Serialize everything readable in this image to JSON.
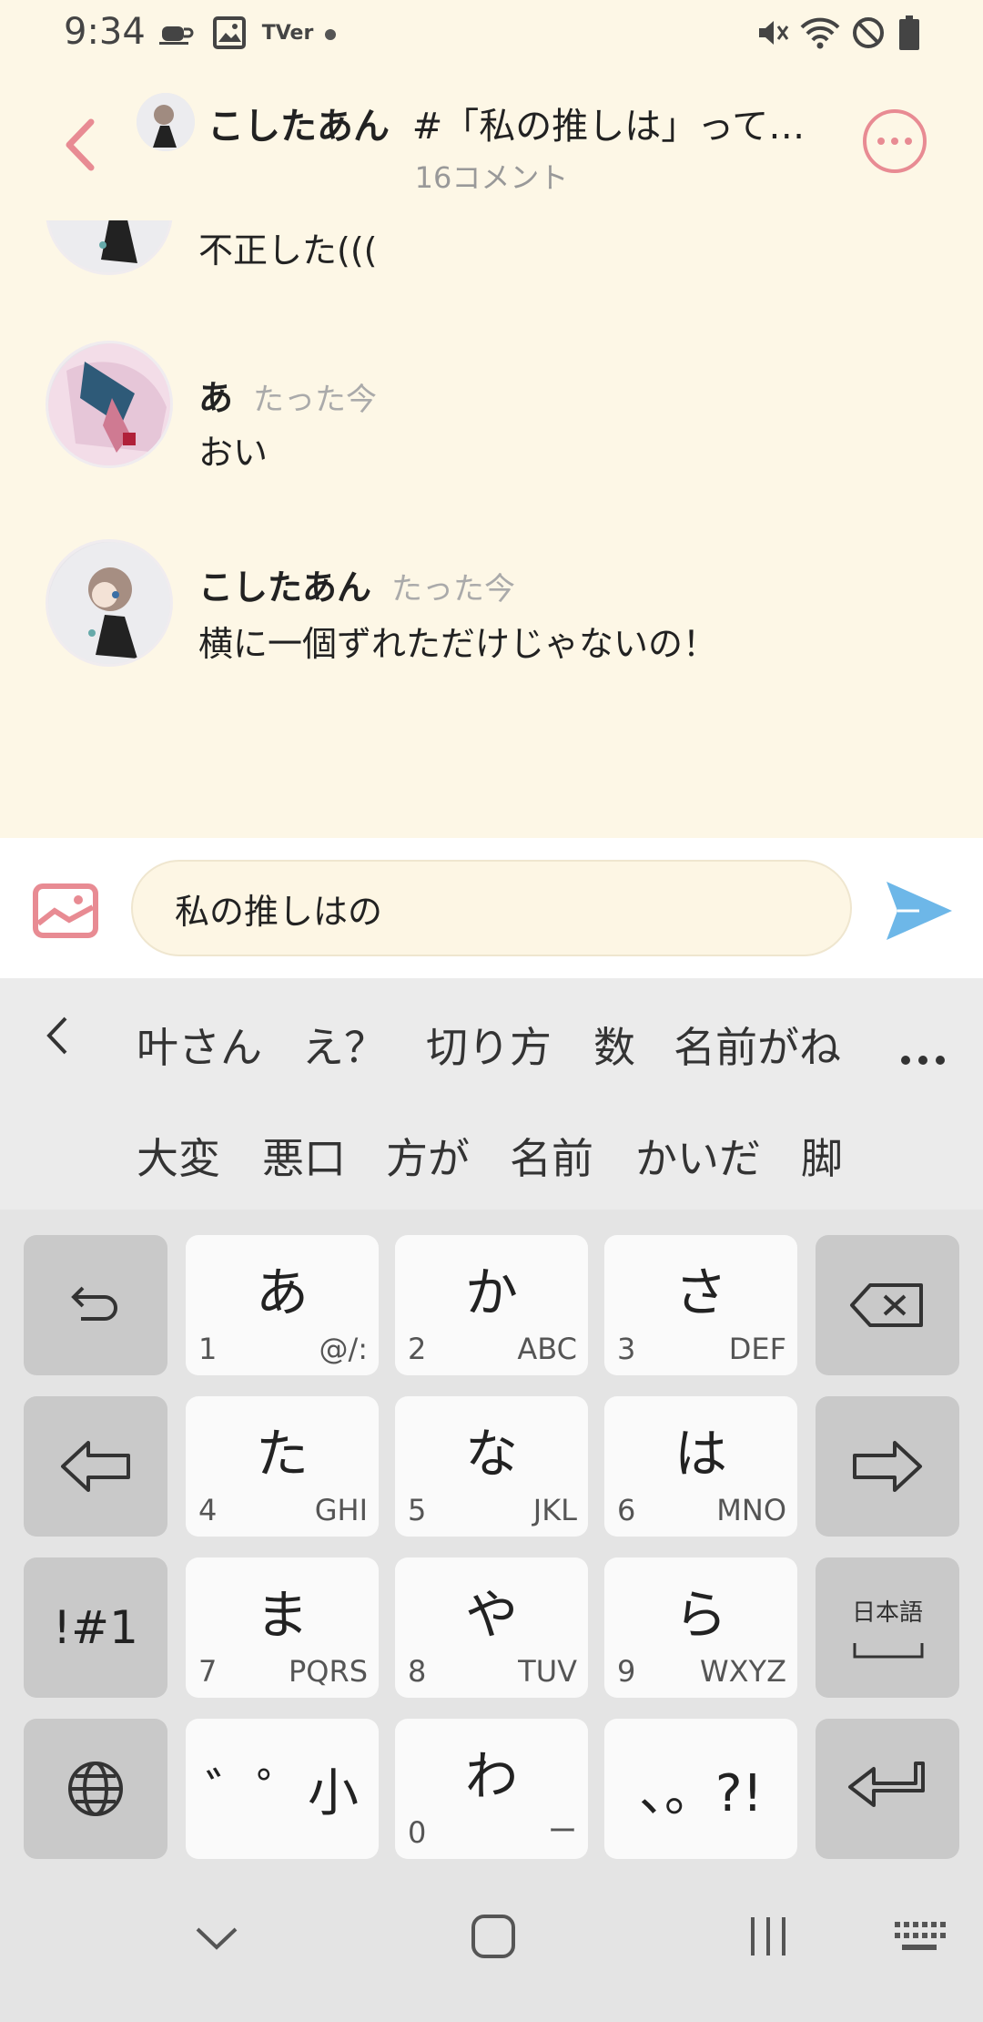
{
  "status": {
    "time": "9:34",
    "app_icon_label": "TVer"
  },
  "header": {
    "user": "こしたあん",
    "title": "#「私の推しは」って打...",
    "subtitle": "16コメント"
  },
  "comments": [
    {
      "name": "",
      "time": "",
      "text": "不正した((("
    },
    {
      "name": "あ",
      "time": "たった今",
      "text": "おい"
    },
    {
      "name": "こしたあん",
      "time": "たった今",
      "text": "横に一個ずれただけじゃないの！"
    }
  ],
  "input": {
    "value": "私の推しはの"
  },
  "suggestions": {
    "row1": [
      "叶さん",
      "え？",
      "切り方",
      "数",
      "名前がね"
    ],
    "row2": [
      "大変",
      "悪口",
      "方が",
      "名前",
      "かいだ",
      "脚"
    ]
  },
  "keyboard": {
    "keys": [
      {
        "main": "あ",
        "num": "1",
        "sub": "@/:"
      },
      {
        "main": "か",
        "num": "2",
        "sub": "ABC"
      },
      {
        "main": "さ",
        "num": "3",
        "sub": "DEF"
      },
      {
        "main": "た",
        "num": "4",
        "sub": "GHI"
      },
      {
        "main": "な",
        "num": "5",
        "sub": "JKL"
      },
      {
        "main": "は",
        "num": "6",
        "sub": "MNO"
      },
      {
        "main": "ま",
        "num": "7",
        "sub": "PQRS"
      },
      {
        "main": "や",
        "num": "8",
        "sub": "TUV"
      },
      {
        "main": "ら",
        "num": "9",
        "sub": "WXYZ"
      },
      {
        "main": "゛゜小",
        "num": "",
        "sub": ""
      },
      {
        "main": "わ",
        "num": "0",
        "sub": "ー"
      },
      {
        "main": "、。?!",
        "num": "",
        "sub": ""
      }
    ],
    "symbol_key": "!#1",
    "lang_key": "日本語"
  },
  "colors": {
    "background": "#fdf7e6",
    "accent_pink": "#e88b93",
    "send_blue": "#6db7e8"
  }
}
